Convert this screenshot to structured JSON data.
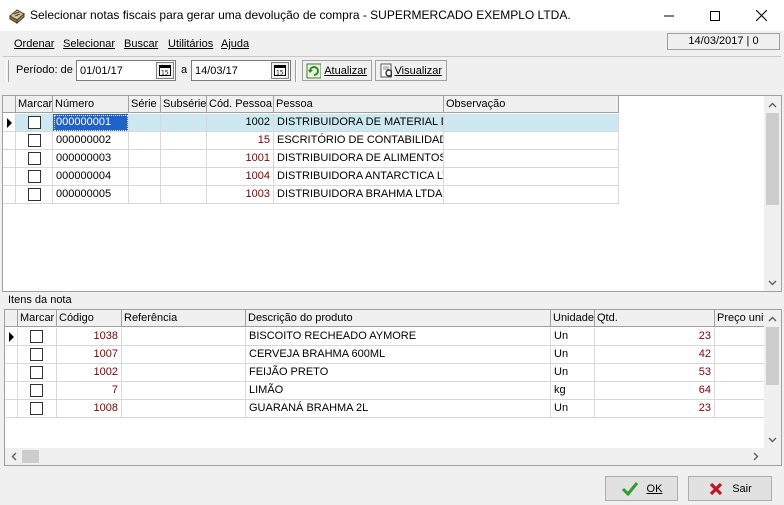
{
  "window": {
    "title": "Selecionar notas fiscais para gerar uma devolução de compra - SUPERMERCADO EXEMPLO LTDA."
  },
  "menu": [
    {
      "label": "Ordenar"
    },
    {
      "label": "Selecionar"
    },
    {
      "label": "Buscar"
    },
    {
      "label": "Utilitários"
    },
    {
      "label": "Ajuda"
    }
  ],
  "status_date": "14/03/2017 | 0",
  "toolbar": {
    "period_label": "Período: de",
    "date_from": "01/01/17",
    "separator_label": "a",
    "date_to": "14/03/17",
    "refresh_label": "Atualizar",
    "view_label": "Visualizar"
  },
  "notes_grid": {
    "columns": [
      "Marcar",
      "Número",
      "Série",
      "Subsérie",
      "Cód. Pessoa",
      "Pessoa",
      "Observação"
    ],
    "rows": [
      {
        "numero": "000000001",
        "serie": "",
        "subserie": "",
        "cod_pessoa": "1002",
        "pessoa": "DISTRIBUIDORA DE MATERIAL DE",
        "observacao": ""
      },
      {
        "numero": "000000002",
        "serie": "",
        "subserie": "",
        "cod_pessoa": "15",
        "pessoa": "ESCRITÓRIO DE CONTABILIDADE",
        "observacao": ""
      },
      {
        "numero": "000000003",
        "serie": "",
        "subserie": "",
        "cod_pessoa": "1001",
        "pessoa": "DISTRIBUIDORA DE ALIMENTOS",
        "observacao": ""
      },
      {
        "numero": "000000004",
        "serie": "",
        "subserie": "",
        "cod_pessoa": "1004",
        "pessoa": "DISTRIBUIDORA ANTARCTICA LTDA",
        "observacao": ""
      },
      {
        "numero": "000000005",
        "serie": "",
        "subserie": "",
        "cod_pessoa": "1003",
        "pessoa": "DISTRIBUIDORA BRAHMA LTDA",
        "observacao": ""
      }
    ]
  },
  "items_label": "Itens da nota",
  "items_grid": {
    "columns": [
      "Marcar",
      "Código",
      "Referência",
      "Descrição do produto",
      "Unidade",
      "Qtd.",
      "Preço unitário"
    ],
    "rows": [
      {
        "codigo": "1038",
        "referencia": "",
        "descricao": "BISCOITO RECHEADO AYMORE",
        "unidade": "Un",
        "qtd": "23",
        "preco": ""
      },
      {
        "codigo": "1007",
        "referencia": "",
        "descricao": "CERVEJA BRAHMA 600ML",
        "unidade": "Un",
        "qtd": "42",
        "preco": ""
      },
      {
        "codigo": "1002",
        "referencia": "",
        "descricao": "FEIJÃO PRETO",
        "unidade": "Un",
        "qtd": "53",
        "preco": ""
      },
      {
        "codigo": "7",
        "referencia": "",
        "descricao": "LIMÃO",
        "unidade": "kg",
        "qtd": "64",
        "preco": ""
      },
      {
        "codigo": "1008",
        "referencia": "",
        "descricao": "GUARANÁ BRAHMA 2L",
        "unidade": "Un",
        "qtd": "23",
        "preco": ""
      }
    ]
  },
  "buttons": {
    "ok_label": "OK",
    "exit_label": "Sair"
  },
  "colors": {
    "selection": "#cde8f0",
    "focus": "#1f62c9",
    "number_text": "#800000",
    "ok_check": "#2e9e2e",
    "exit_x": "#c0102a"
  }
}
